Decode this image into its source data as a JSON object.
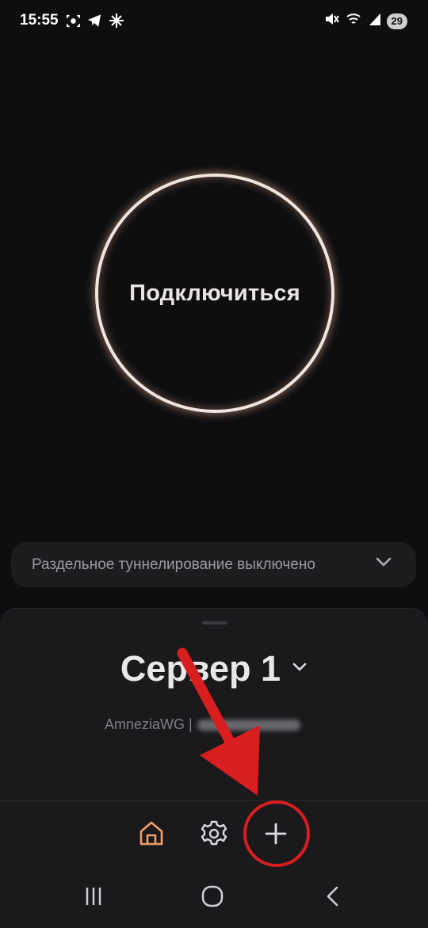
{
  "status_bar": {
    "time": "15:55",
    "battery_level": "29",
    "icons_left": [
      "screenshot-icon",
      "telegram-icon",
      "sparkle-icon"
    ],
    "icons_right": [
      "mute-icon",
      "wifi-icon",
      "signal-icon",
      "battery-icon"
    ]
  },
  "connect": {
    "label": "Подключиться",
    "ring_color": "#efe6df",
    "glow_color": "#d6a078"
  },
  "split_tunneling": {
    "label": "Раздельное туннелирование выключено"
  },
  "server": {
    "name": "Сервер 1",
    "protocol_prefix": "AmneziaWG | "
  },
  "bottom_nav": {
    "tabs": [
      {
        "id": "home",
        "icon": "home-icon",
        "active": true,
        "color": "#f0a066"
      },
      {
        "id": "settings",
        "icon": "gear-icon",
        "active": false,
        "color": "#d8d8dc"
      },
      {
        "id": "add",
        "icon": "plus-icon",
        "active": false,
        "color": "#d8d8dc"
      }
    ]
  },
  "system_nav": [
    "recents-icon",
    "home-circle-icon",
    "back-icon"
  ],
  "annotation": {
    "color": "#d81e1e",
    "target": "add-tab"
  }
}
